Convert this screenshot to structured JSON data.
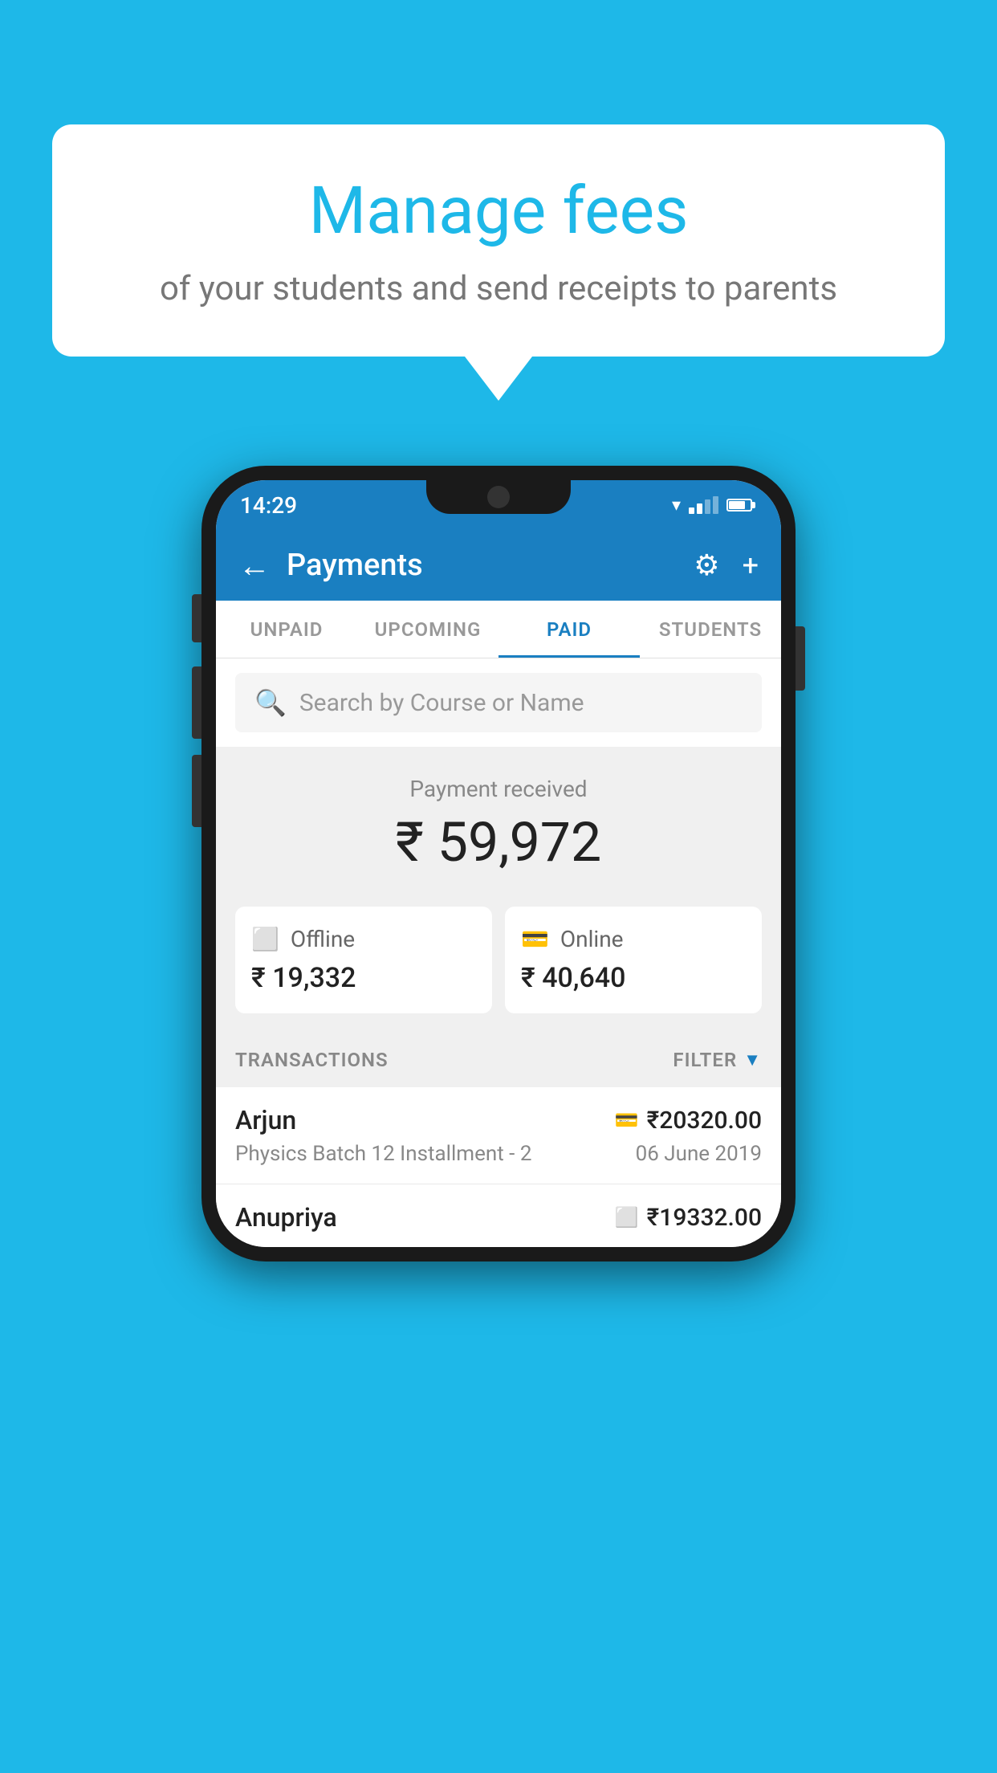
{
  "background_color": "#1eb8e8",
  "bubble": {
    "title": "Manage fees",
    "subtitle": "of your students and send receipts to parents"
  },
  "status_bar": {
    "time": "14:29"
  },
  "header": {
    "title": "Payments",
    "back_label": "←",
    "settings_label": "⚙",
    "add_label": "+"
  },
  "tabs": [
    {
      "label": "UNPAID",
      "active": false
    },
    {
      "label": "UPCOMING",
      "active": false
    },
    {
      "label": "PAID",
      "active": true
    },
    {
      "label": "STUDENTS",
      "active": false
    }
  ],
  "search": {
    "placeholder": "Search by Course or Name"
  },
  "payment_received": {
    "label": "Payment received",
    "amount": "₹ 59,972"
  },
  "cards": [
    {
      "type": "Offline",
      "amount": "₹ 19,332"
    },
    {
      "type": "Online",
      "amount": "₹ 40,640"
    }
  ],
  "transactions_label": "TRANSACTIONS",
  "filter_label": "FILTER",
  "transactions": [
    {
      "name": "Arjun",
      "course": "Physics Batch 12 Installment - 2",
      "amount": "₹20320.00",
      "date": "06 June 2019",
      "payment_type": "online"
    },
    {
      "name": "Anupriya",
      "course": "",
      "amount": "₹19332.00",
      "date": "",
      "payment_type": "offline"
    }
  ]
}
